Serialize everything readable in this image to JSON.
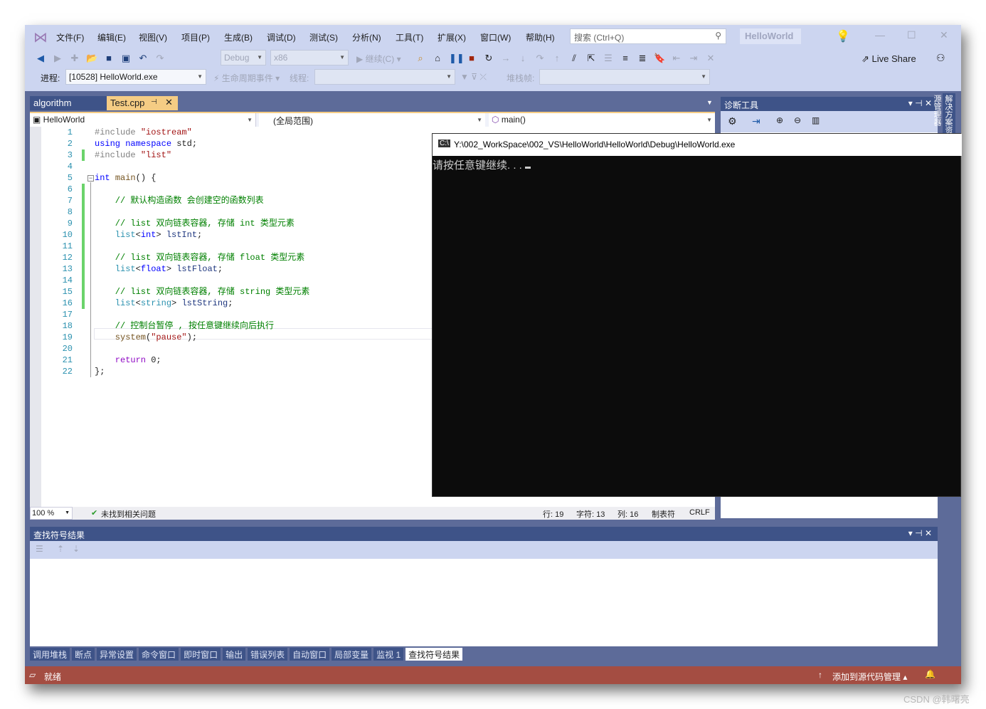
{
  "menu": [
    "文件(F)",
    "编辑(E)",
    "视图(V)",
    "项目(P)",
    "生成(B)",
    "调试(D)",
    "测试(S)",
    "分析(N)",
    "工具(T)",
    "扩展(X)",
    "窗口(W)",
    "帮助(H)"
  ],
  "search_placeholder": "搜索 (Ctrl+Q)",
  "solution_name": "HelloWorld",
  "toolbar": {
    "config": "Debug",
    "platform": "x86",
    "continue": "继续(C)",
    "live_share": "Live Share"
  },
  "debug_bar": {
    "process_label": "进程:",
    "process_value": "[10528] HelloWorld.exe",
    "lifecycle": "生命周期事件",
    "thread_label": "线程:",
    "stack_label": "堆栈帧:"
  },
  "doc_tabs": [
    {
      "label": "algorithm"
    },
    {
      "label": "Test.cpp"
    }
  ],
  "nav": {
    "project": "HelloWorld",
    "scope": "(全局范围)",
    "member": "main()"
  },
  "code": [
    [
      [
        "#include ",
        "pp"
      ],
      [
        "\"iostream\"",
        "st"
      ]
    ],
    [
      [
        "using ",
        "kw"
      ],
      [
        "namespace ",
        "kw"
      ],
      [
        "std;",
        "tx"
      ]
    ],
    [
      [
        "#include ",
        "pp"
      ],
      [
        "\"list\"",
        "st"
      ]
    ],
    [],
    [
      [
        "int ",
        "kw"
      ],
      [
        "main",
        "fn"
      ],
      [
        "() {",
        "tx"
      ]
    ],
    [],
    [
      [
        "    // 默认构造函数 会创建空的函数列表",
        "cm"
      ]
    ],
    [],
    [
      [
        "    // list 双向链表容器, 存储 int 类型元素",
        "cm"
      ]
    ],
    [
      [
        "    list",
        "ty"
      ],
      [
        "<",
        "tx"
      ],
      [
        "int",
        "kw"
      ],
      [
        "> ",
        "tx"
      ],
      [
        "lstInt",
        "id"
      ],
      [
        ";",
        "tx"
      ]
    ],
    [],
    [
      [
        "    // list 双向链表容器, 存储 float 类型元素",
        "cm"
      ]
    ],
    [
      [
        "    list",
        "ty"
      ],
      [
        "<",
        "tx"
      ],
      [
        "float",
        "kw"
      ],
      [
        "> ",
        "tx"
      ],
      [
        "lstFloat",
        "id"
      ],
      [
        ";",
        "tx"
      ]
    ],
    [],
    [
      [
        "    // list 双向链表容器, 存储 string 类型元素",
        "cm"
      ]
    ],
    [
      [
        "    list",
        "ty"
      ],
      [
        "<",
        "tx"
      ],
      [
        "string",
        "ty"
      ],
      [
        "> ",
        "tx"
      ],
      [
        "lstString",
        "id"
      ],
      [
        ";",
        "tx"
      ]
    ],
    [],
    [
      [
        "    // 控制台暂停 , 按任意键继续向后执行",
        "cm"
      ]
    ],
    [
      [
        "    system",
        "fn"
      ],
      [
        "(",
        "tx"
      ],
      [
        "\"pause\"",
        "st"
      ],
      [
        ");",
        "tx"
      ]
    ],
    [],
    [
      [
        "    return ",
        "rt"
      ],
      [
        "0;",
        "tx"
      ]
    ],
    [
      [
        "};",
        "tx"
      ]
    ]
  ],
  "changed_lines": [
    3,
    6,
    7,
    8,
    9,
    10,
    11,
    12,
    13,
    14,
    15,
    16
  ],
  "editor_status": {
    "zoom": "100 %",
    "issues": "未找到相关问题",
    "line": "行: 19",
    "char": "字符: 13",
    "col": "列: 16",
    "indent": "制表符",
    "eol": "CRLF"
  },
  "diagnostics": {
    "title": "诊断工具"
  },
  "console": {
    "title": "Y:\\002_WorkSpace\\002_VS\\HelloWorld\\HelloWorld\\Debug\\HelloWorld.exe",
    "output": "请按任意键继续. . . "
  },
  "bottom_panel": {
    "title": "查找符号结果"
  },
  "bottom_tabs": [
    "调用堆栈",
    "断点",
    "异常设置",
    "命令窗口",
    "即时窗口",
    "输出",
    "错误列表",
    "自动窗口",
    "局部变量",
    "监视 1",
    "查找符号结果"
  ],
  "active_bottom_tab": "查找符号结果",
  "side_tab": "解决方案资源管理器",
  "status": {
    "ready": "就绪",
    "source_control": "添加到源代码管理"
  },
  "watermark": "CSDN @韩曙亮",
  "colors": {
    "status_bar": "#a44d42",
    "active_tab": "#f5cc84",
    "panel_header": "#3e5388",
    "chrome": "#ccd5f0"
  }
}
